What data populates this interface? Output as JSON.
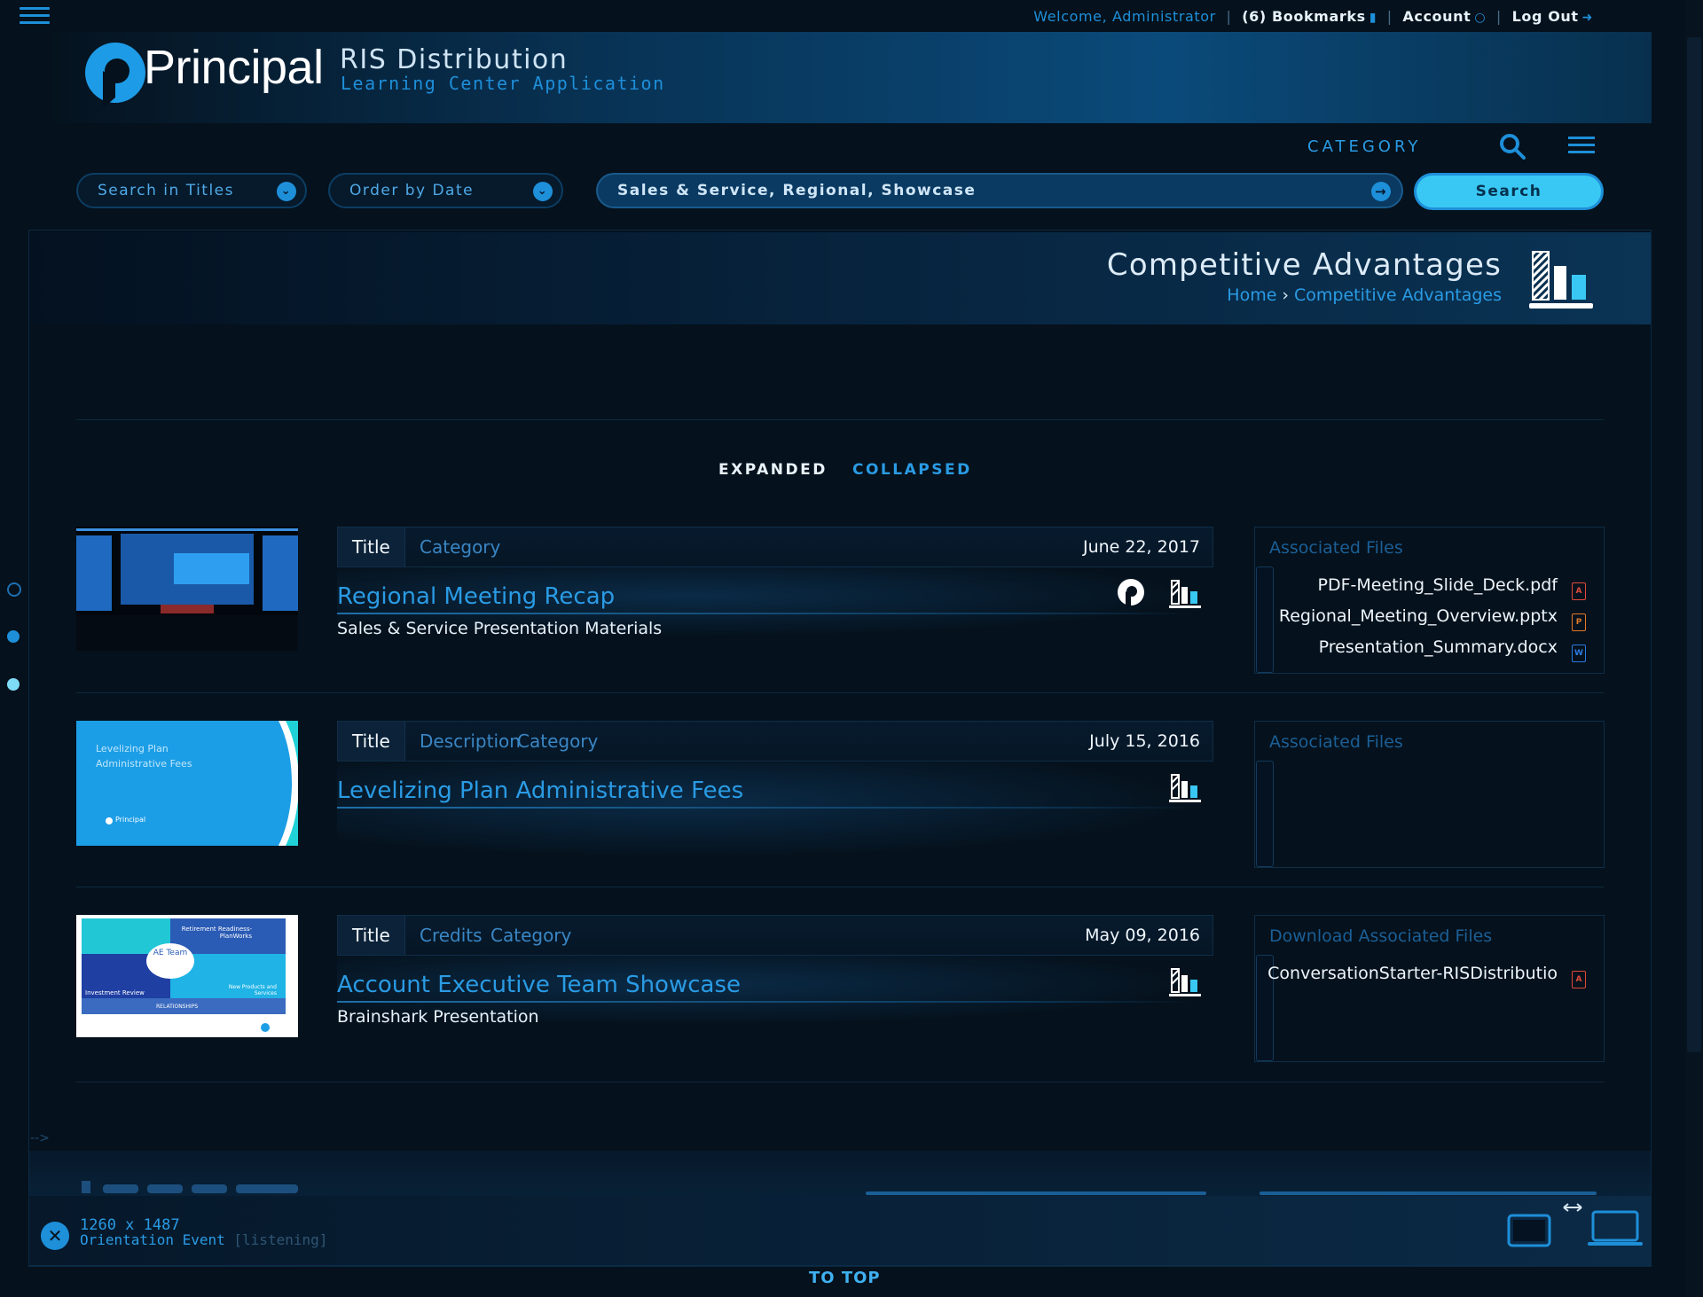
{
  "userbar": {
    "welcome": "Welcome, Administrator",
    "bookmarks": "(6) Bookmarks",
    "account": "Account",
    "logout": "Log Out"
  },
  "brand": {
    "logo_word": "Principal",
    "app_title": "RIS Distribution",
    "app_subtitle": "Learning Center Application"
  },
  "toolbar": {
    "category_label": "CATEGORY",
    "search_in": "Search in Titles",
    "order_by": "Order by Date",
    "query": "Sales & Service, Regional, Showcase",
    "search_button": "Search"
  },
  "page": {
    "title": "Competitive Advantages",
    "breadcrumb_home": "Home",
    "breadcrumb_current": "Competitive Advantages"
  },
  "view_toggle": {
    "expanded": "EXPANDED",
    "collapsed": "COLLAPSED"
  },
  "items": [
    {
      "tabs": [
        "Title",
        "Category"
      ],
      "date": "June 22, 2017",
      "title": "Regional Meeting Recap",
      "subtitle": "Sales & Service Presentation Materials",
      "files_heading": "Associated Files",
      "files": [
        "PDF-Meeting_Slide_Deck.pdf",
        "Regional_Meeting_Overview.pptx",
        "Presentation_Summary.docx"
      ]
    },
    {
      "tabs": [
        "Title",
        "Description",
        "Category"
      ],
      "date": "July 15, 2016",
      "title": "Levelizing Plan Administrative Fees",
      "subtitle": "",
      "files_heading": "Associated Files",
      "files": [],
      "thumb_text_1": "Levelizing Plan",
      "thumb_text_2": "Administrative Fees",
      "thumb_logo": "Principal"
    },
    {
      "tabs": [
        "Title",
        "Credits",
        "Category"
      ],
      "date": "May 09, 2016",
      "title": "Account Executive Team Showcase",
      "subtitle": "Brainshark Presentation",
      "files_heading": "Download Associated Files",
      "files": [
        "ConversationStarter-RISDistributio"
      ],
      "thumb_labels": [
        "Retirement Readiness-PlanWorks",
        "AE Team",
        "Investment Review",
        "New Products and Services",
        "RELATIONSHIPS"
      ]
    }
  ],
  "device": {
    "dimensions": "1260 x 1487",
    "orientation_label": "Orientation Event",
    "orientation_state": "[listening]"
  },
  "footer": {
    "to_top": "TO TOP"
  },
  "colors": {
    "background": "#05111c",
    "accent": "#1e8fd9",
    "accent_light": "#39c8f3",
    "text": "#d6e6f2"
  }
}
